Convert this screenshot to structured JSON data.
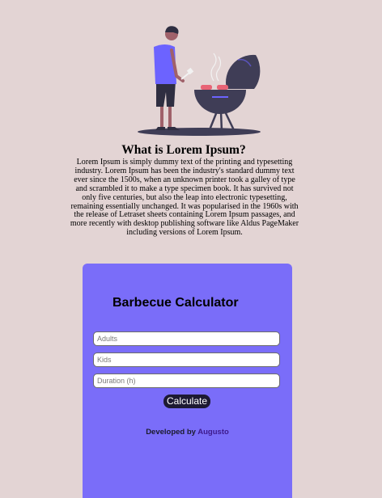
{
  "intro": {
    "title": "What is Lorem Ipsum?",
    "text": "Lorem Ipsum is simply dummy text of the printing and typesetting industry. Lorem Ipsum has been the industry's standard dummy text ever since the 1500s, when an unknown printer took a galley of type and scrambled it to make a type specimen book. It has survived not only five centuries, but also the leap into electronic typesetting, remaining essentially unchanged. It was popularised in the 1960s with the release of Letraset sheets containing Lorem Ipsum passages, and more recently with desktop publishing software like Aldus PageMaker including versions of Lorem Ipsum.",
    "illustration": "person-grilling-barbecue-illustration"
  },
  "calculator": {
    "title": "Barbecue Calculator",
    "adults_placeholder": "Adults",
    "kids_placeholder": "Kids",
    "duration_placeholder": "Duration (h)",
    "button_label": "Calculate",
    "credit_prefix": "Developed by",
    "credit_author": "Augusto"
  },
  "colors": {
    "page_background": "#e3d4d4",
    "card_background": "#7a6df9",
    "button_background": "#1d1a33",
    "author_link": "#3d1a8c"
  }
}
